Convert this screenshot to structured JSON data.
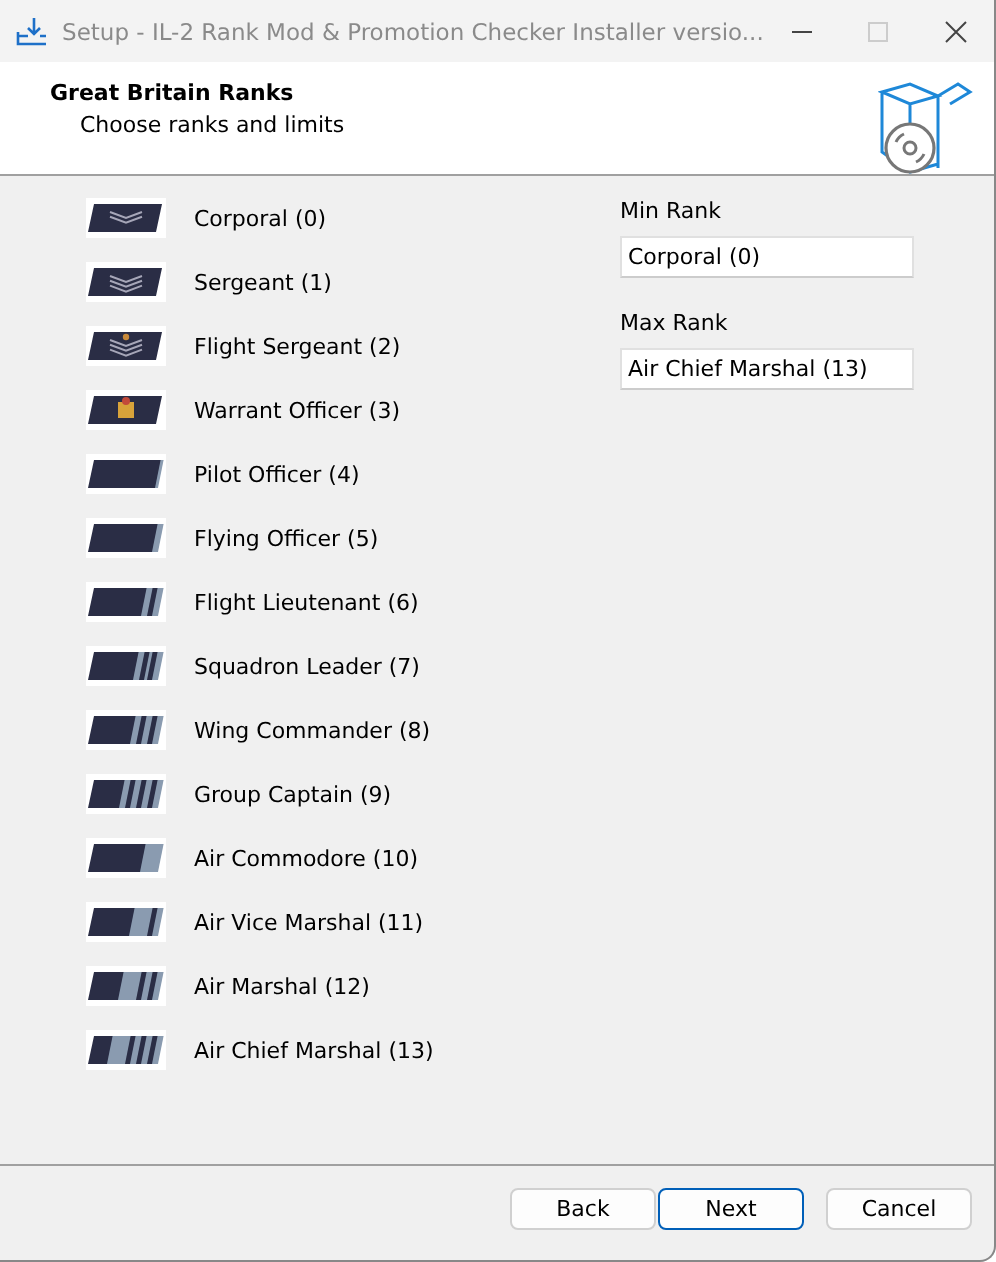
{
  "window": {
    "title": "Setup - IL-2 Rank Mod & Promotion Checker Installer versio..."
  },
  "header": {
    "title": "Great Britain Ranks",
    "subtitle": "Choose ranks and limits"
  },
  "ranks": [
    {
      "label": "Corporal (0)",
      "insignia": {
        "kind": "chevrons",
        "chevrons": [
          {
            "kind": "chevron"
          },
          {
            "kind": "chevron"
          }
        ],
        "crown": false
      }
    },
    {
      "label": "Sergeant (1)",
      "insignia": {
        "kind": "chevrons",
        "chevrons": [
          {
            "kind": "chevron"
          },
          {
            "kind": "chevron"
          },
          {
            "kind": "chevron"
          }
        ],
        "crown": false
      }
    },
    {
      "label": "Flight Sergeant (2)",
      "insignia": {
        "kind": "chevrons",
        "chevrons": [
          {
            "kind": "chevron"
          },
          {
            "kind": "chevron"
          },
          {
            "kind": "chevron"
          }
        ],
        "crown": true
      }
    },
    {
      "label": "Warrant Officer (3)",
      "insignia": {
        "kind": "crest"
      }
    },
    {
      "label": "Pilot Officer (4)",
      "insignia": {
        "kind": "stripes",
        "stripes": [
          {
            "kind": "thin"
          }
        ]
      }
    },
    {
      "label": "Flying Officer (5)",
      "insignia": {
        "kind": "stripes",
        "stripes": [
          {
            "kind": "thick"
          }
        ]
      }
    },
    {
      "label": "Flight Lieutenant (6)",
      "insignia": {
        "kind": "stripes",
        "stripes": [
          {
            "kind": "thick"
          },
          {
            "kind": "thick"
          }
        ]
      }
    },
    {
      "label": "Squadron Leader (7)",
      "insignia": {
        "kind": "stripes",
        "stripes": [
          {
            "kind": "thick"
          },
          {
            "kind": "thin"
          },
          {
            "kind": "thick"
          }
        ]
      }
    },
    {
      "label": "Wing Commander (8)",
      "insignia": {
        "kind": "stripes",
        "stripes": [
          {
            "kind": "thick"
          },
          {
            "kind": "thick"
          },
          {
            "kind": "thick"
          }
        ]
      }
    },
    {
      "label": "Group Captain (9)",
      "insignia": {
        "kind": "stripes",
        "stripes": [
          {
            "kind": "thick"
          },
          {
            "kind": "thick"
          },
          {
            "kind": "thick"
          },
          {
            "kind": "thick"
          }
        ]
      }
    },
    {
      "label": "Air Commodore (10)",
      "insignia": {
        "kind": "stripes",
        "stripes": [
          {
            "kind": "wide"
          }
        ]
      }
    },
    {
      "label": "Air Vice Marshal (11)",
      "insignia": {
        "kind": "stripes",
        "stripes": [
          {
            "kind": "wide"
          },
          {
            "kind": "thick"
          }
        ]
      }
    },
    {
      "label": "Air Marshal (12)",
      "insignia": {
        "kind": "stripes",
        "stripes": [
          {
            "kind": "wide"
          },
          {
            "kind": "thick"
          },
          {
            "kind": "thick"
          }
        ]
      }
    },
    {
      "label": "Air Chief Marshal (13)",
      "insignia": {
        "kind": "stripes",
        "stripes": [
          {
            "kind": "wide"
          },
          {
            "kind": "thick"
          },
          {
            "kind": "thick"
          },
          {
            "kind": "thick"
          }
        ]
      }
    }
  ],
  "limits": [
    {
      "label": "Min Rank",
      "value": "Corporal (0)"
    },
    {
      "label": "Max Rank",
      "value": "Air Chief Marshal (13)"
    }
  ],
  "buttons": [
    {
      "label": "Back",
      "default": false
    },
    {
      "label": "Next",
      "default": true
    },
    {
      "label": "Cancel",
      "default": false
    }
  ]
}
